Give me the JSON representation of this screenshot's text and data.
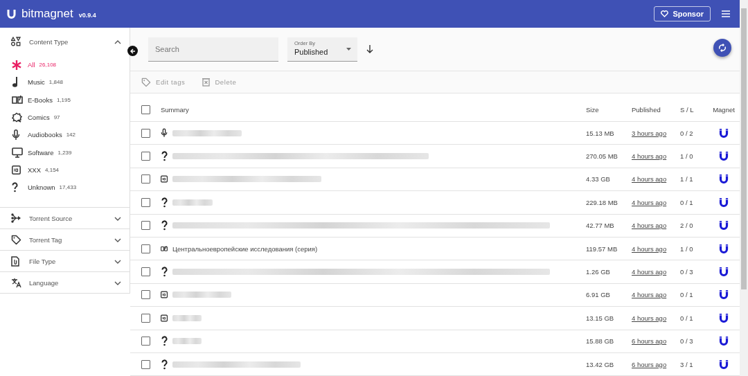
{
  "header": {
    "title": "bitmagnet",
    "version": "v0.9.4",
    "sponsor": "Sponsor"
  },
  "sidebar": {
    "sections": [
      {
        "kind": "content-type",
        "label": "Content Type",
        "expanded": true,
        "items": [
          {
            "kind": "all",
            "label": "All",
            "count": "26,108",
            "selected": true
          },
          {
            "kind": "music",
            "label": "Music",
            "count": "1,848",
            "selected": false
          },
          {
            "kind": "ebook",
            "label": "E-Books",
            "count": "1,195",
            "selected": false
          },
          {
            "kind": "comic",
            "label": "Comics",
            "count": "97",
            "selected": false
          },
          {
            "kind": "audiobook",
            "label": "Audiobooks",
            "count": "142",
            "selected": false
          },
          {
            "kind": "software",
            "label": "Software",
            "count": "1,239",
            "selected": false
          },
          {
            "kind": "xxx",
            "label": "XXX",
            "count": "4,154",
            "selected": false
          },
          {
            "kind": "unknown",
            "label": "Unknown",
            "count": "17,433",
            "selected": false
          }
        ]
      },
      {
        "kind": "source",
        "label": "Torrent Source",
        "expanded": false
      },
      {
        "kind": "tag",
        "label": "Torrent Tag",
        "expanded": false
      },
      {
        "kind": "file",
        "label": "File Type",
        "expanded": false
      },
      {
        "kind": "language",
        "label": "Language",
        "expanded": false
      }
    ]
  },
  "search": {
    "placeholder": "Search"
  },
  "order_by": {
    "label": "Order By",
    "value": "Published"
  },
  "actions": [
    "Edit tags",
    "Delete"
  ],
  "table": {
    "select_all": {
      "checked": false
    },
    "columns": [
      "Summary",
      "Size",
      "Published",
      "S / L",
      "Magnet"
    ],
    "rows": [
      {
        "kind": "audiobook",
        "redacted": true,
        "size": "15.13 MB",
        "published": "3 hours ago",
        "sl": "0 / 2",
        "checked": false
      },
      {
        "kind": "unknown",
        "redacted": true,
        "size": "270.05 MB",
        "published": "4 hours ago",
        "sl": "1 / 0",
        "checked": false
      },
      {
        "kind": "xxx",
        "redacted": true,
        "size": "4.33 GB",
        "published": "4 hours ago",
        "sl": "1 / 1",
        "checked": false
      },
      {
        "kind": "unknown",
        "redacted": true,
        "size": "229.18 MB",
        "published": "4 hours ago",
        "sl": "0 / 1",
        "checked": false
      },
      {
        "kind": "unknown",
        "redacted": true,
        "size": "42.77 MB",
        "published": "4 hours ago",
        "sl": "2 / 0",
        "checked": false
      },
      {
        "kind": "ebook",
        "redacted": false,
        "summary": "Центральноевропейские исследования (серия)",
        "size": "119.57 MB",
        "published": "4 hours ago",
        "sl": "1 / 0",
        "checked": false
      },
      {
        "kind": "unknown",
        "redacted": true,
        "size": "1.26 GB",
        "published": "4 hours ago",
        "sl": "0 / 3",
        "checked": false
      },
      {
        "kind": "xxx",
        "redacted": true,
        "size": "6.91 GB",
        "published": "4 hours ago",
        "sl": "0 / 1",
        "checked": false
      },
      {
        "kind": "xxx",
        "redacted": true,
        "size": "13.15 GB",
        "published": "4 hours ago",
        "sl": "0 / 1",
        "checked": false
      },
      {
        "kind": "unknown",
        "redacted": true,
        "size": "15.88 GB",
        "published": "6 hours ago",
        "sl": "0 / 3",
        "checked": false
      },
      {
        "kind": "unknown",
        "redacted": true,
        "size": "13.42 GB",
        "published": "6 hours ago",
        "sl": "3 / 1",
        "checked": false
      }
    ]
  }
}
